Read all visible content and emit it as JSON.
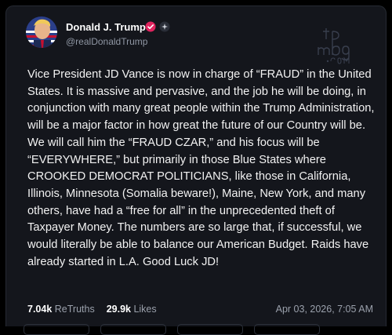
{
  "post": {
    "author": {
      "name": "Donald J. Trump",
      "handle": "@realDonaldTrump",
      "verified": true,
      "verified_color": "#e0245e"
    },
    "watermark": "tp mbg.com",
    "text": "Vice President JD Vance is now in charge of “FRAUD” in the United States. It is massive and pervasive, and the job he will be doing, in conjunction with many great people within the Trump Administration, will be a major factor in how great the future of our Country will be. We will call him the “FRAUD CZAR,” and his focus will be “EVERYWHERE,” but primarily in those Blue States where CROOKED DEMOCRAT POLITICIANS, like those in California, Illinois, Minnesota (Somalia beware!), Maine, New York, and many others, have had a “free for all” in the unprecedented theft of Taxpayer Money. The numbers are so large that, if successful, we would literally be able to balance our American Budget. Raids have already started in L.A. Good Luck JD!",
    "stats": {
      "retruths_count": "7.04k",
      "retruths_label": "ReTruths",
      "likes_count": "29.9k",
      "likes_label": "Likes"
    },
    "timestamp": "Apr 03, 2026, 7:05 AM"
  }
}
